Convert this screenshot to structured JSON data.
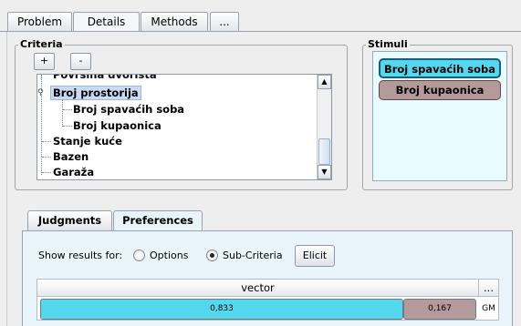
{
  "main_tabs": [
    {
      "label": "Problem",
      "active": false
    },
    {
      "label": "Details",
      "active": true
    },
    {
      "label": "Methods",
      "active": false
    },
    {
      "label": "...",
      "active": false
    }
  ],
  "criteria": {
    "title": "Criteria",
    "add_label": "+",
    "remove_label": "-",
    "tree": [
      {
        "label": "Površina dvorišta",
        "level": 1
      },
      {
        "label": "Broj prostorija",
        "level": 1,
        "selected": true,
        "expanded": true
      },
      {
        "label": "Broj spavaćih soba",
        "level": 2
      },
      {
        "label": "Broj kupaonica",
        "level": 2
      },
      {
        "label": "Stanje kuće",
        "level": 1
      },
      {
        "label": "Bazen",
        "level": 1
      },
      {
        "label": "Garaža",
        "level": 1
      }
    ]
  },
  "stimuli": {
    "title": "Stimuli",
    "items": [
      {
        "label": "Broj spavaćih soba",
        "color": "#54d8ee"
      },
      {
        "label": "Broj kupaonica",
        "color": "#b49a9a"
      }
    ]
  },
  "inner_tabs": [
    {
      "label": "Judgments",
      "active": false
    },
    {
      "label": "Preferences",
      "active": true
    }
  ],
  "preferences": {
    "show_results_label": "Show results for:",
    "options": [
      {
        "label": "Options",
        "selected": false
      },
      {
        "label": "Sub-Criteria",
        "selected": true
      }
    ],
    "elicit_label": "Elicit",
    "column_header": "vector",
    "more_header": "...",
    "row_tag": "GM",
    "values": [
      {
        "label": "0,833",
        "value": 0.833,
        "color": "#54d8ee"
      },
      {
        "label": "0,167",
        "value": 0.167,
        "color": "#b49a9a"
      }
    ]
  }
}
